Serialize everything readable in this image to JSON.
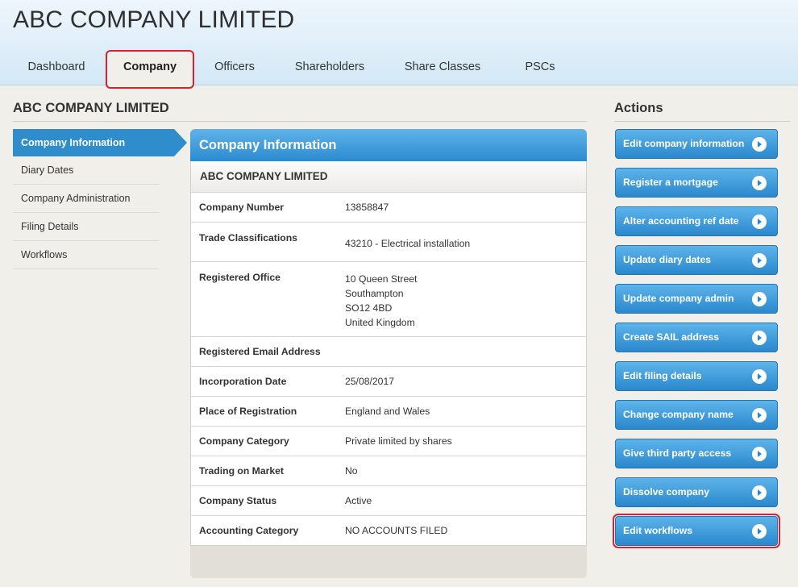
{
  "header": {
    "title": "ABC COMPANY LIMITED",
    "tabs": [
      {
        "label": "Dashboard"
      },
      {
        "label": "Company"
      },
      {
        "label": "Officers"
      },
      {
        "label": "Shareholders"
      },
      {
        "label": "Share Classes"
      },
      {
        "label": "PSCs"
      }
    ],
    "active_tab": "Company"
  },
  "page_heading": "ABC COMPANY LIMITED",
  "left_nav": {
    "items": [
      {
        "label": "Company Information"
      },
      {
        "label": "Diary Dates"
      },
      {
        "label": "Company Administration"
      },
      {
        "label": "Filing Details"
      },
      {
        "label": "Workflows"
      }
    ]
  },
  "panel": {
    "title": "Company Information",
    "subtitle": "ABC COMPANY LIMITED",
    "rows": [
      {
        "label": "Company Number",
        "value": "13858847"
      },
      {
        "label": "Trade Classifications",
        "value": "43210 - Electrical installation"
      },
      {
        "label": "Registered Office",
        "lines": [
          "10 Queen Street",
          "Southampton",
          "SO12 4BD",
          "United Kingdom"
        ]
      },
      {
        "label": "Registered Email Address",
        "value": ""
      },
      {
        "label": "Incorporation Date",
        "value": "25/08/2017"
      },
      {
        "label": "Place of Registration",
        "value": "England and Wales"
      },
      {
        "label": "Company Category",
        "value": "Private limited by shares"
      },
      {
        "label": "Trading on Market",
        "value": "No"
      },
      {
        "label": "Company Status",
        "value": "Active"
      },
      {
        "label": "Accounting Category",
        "value": "NO ACCOUNTS FILED"
      }
    ]
  },
  "actions": {
    "heading": "Actions",
    "buttons": [
      {
        "label": "Edit company information"
      },
      {
        "label": "Register a mortgage"
      },
      {
        "label": "Alter accounting ref date"
      },
      {
        "label": "Update diary dates"
      },
      {
        "label": "Update company admin"
      },
      {
        "label": "Create SAIL address"
      },
      {
        "label": "Edit filing details"
      },
      {
        "label": "Change company name"
      },
      {
        "label": "Give third party access"
      },
      {
        "label": "Dissolve company"
      },
      {
        "label": "Edit workflows"
      }
    ]
  },
  "colors": {
    "accent_blue": "#2f8dcc",
    "highlight_red": "#d8202e",
    "background": "#f1efe9"
  }
}
